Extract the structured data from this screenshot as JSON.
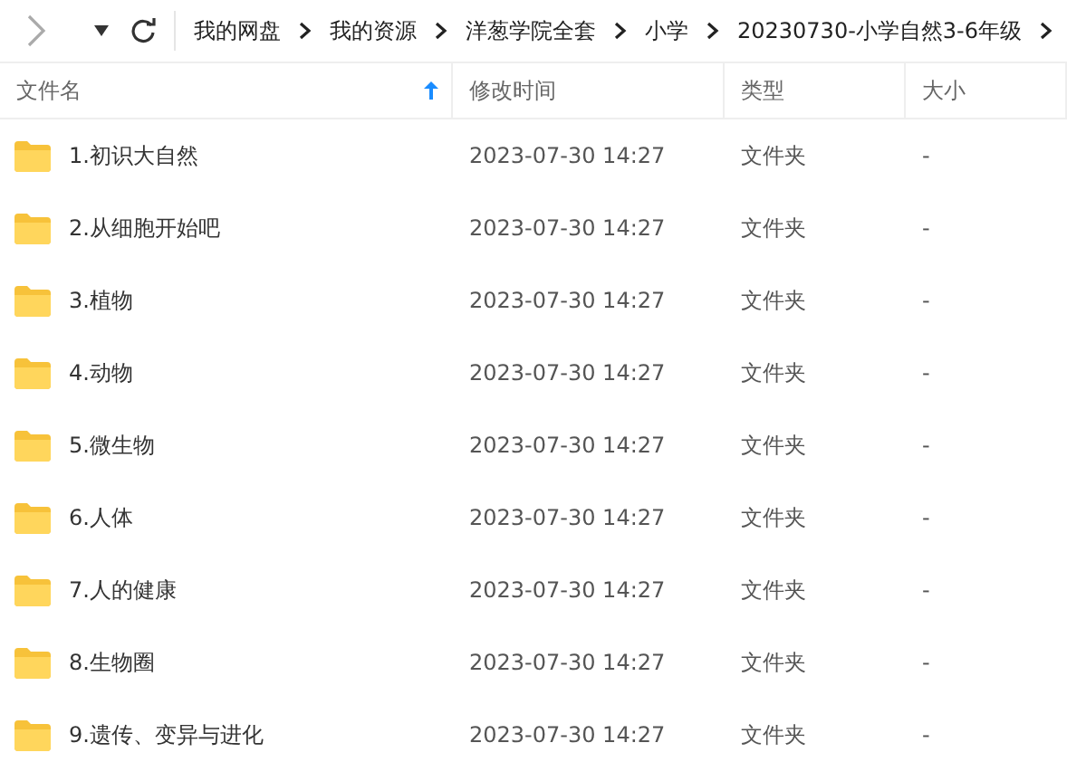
{
  "toolbar": {
    "breadcrumbs": [
      "我的网盘",
      "我的资源",
      "洋葱学院全套",
      "小学",
      "20230730-小学自然3-6年级"
    ]
  },
  "table": {
    "columns": [
      {
        "label": "文件名",
        "sorted": true
      },
      {
        "label": "修改时间",
        "sorted": false
      },
      {
        "label": "类型",
        "sorted": false
      },
      {
        "label": "大小",
        "sorted": false
      }
    ],
    "rows": [
      {
        "name": "1.初识大自然",
        "modified": "2023-07-30 14:27",
        "type": "文件夹",
        "size": "-"
      },
      {
        "name": "2.从细胞开始吧",
        "modified": "2023-07-30 14:27",
        "type": "文件夹",
        "size": "-"
      },
      {
        "name": "3.植物",
        "modified": "2023-07-30 14:27",
        "type": "文件夹",
        "size": "-"
      },
      {
        "name": "4.动物",
        "modified": "2023-07-30 14:27",
        "type": "文件夹",
        "size": "-"
      },
      {
        "name": "5.微生物",
        "modified": "2023-07-30 14:27",
        "type": "文件夹",
        "size": "-"
      },
      {
        "name": "6.人体",
        "modified": "2023-07-30 14:27",
        "type": "文件夹",
        "size": "-"
      },
      {
        "name": "7.人的健康",
        "modified": "2023-07-30 14:27",
        "type": "文件夹",
        "size": "-"
      },
      {
        "name": "8.生物圈",
        "modified": "2023-07-30 14:27",
        "type": "文件夹",
        "size": "-"
      },
      {
        "name": "9.遗传、变异与进化",
        "modified": "2023-07-30 14:27",
        "type": "文件夹",
        "size": "-"
      }
    ]
  }
}
